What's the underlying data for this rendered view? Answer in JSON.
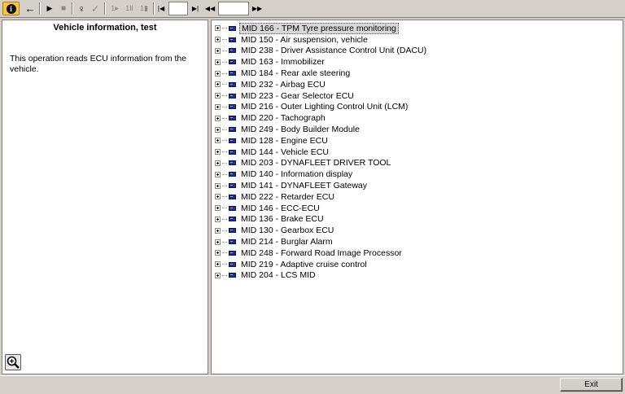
{
  "toolbar": {
    "info_glyph": "i",
    "back_glyph": "←",
    "play_glyph": "▶",
    "stop_glyph": "■",
    "inspect_glyph": "♀",
    "check_glyph": "✓",
    "step1_glyph": "1▸",
    "step2_glyph": "1Ⅱ",
    "step3_glyph": "1▮",
    "first_glyph": "|◀",
    "page_value": "",
    "last_glyph": "▶|",
    "rewind_glyph": "◀◀",
    "search_value": "",
    "forward_glyph": "▶▶"
  },
  "left_panel": {
    "title": "Vehicle information, test",
    "description": "This operation reads ECU information from the vehicle."
  },
  "tree": {
    "items": [
      {
        "label": "MID 166 - TPM Tyre pressure monitoring",
        "selected": true
      },
      {
        "label": "MID 150 - Air suspension, vehicle"
      },
      {
        "label": "MID 238 - Driver Assistance Control Unit (DACU)"
      },
      {
        "label": "MID 163 - Immobilizer"
      },
      {
        "label": "MID 184 - Rear axle steering"
      },
      {
        "label": "MID 232 - Airbag ECU"
      },
      {
        "label": "MID 223 - Gear Selector ECU"
      },
      {
        "label": "MID 216 - Outer Lighting Control Unit (LCM)"
      },
      {
        "label": "MID 220 - Tachograph"
      },
      {
        "label": "MID 249 - Body Builder Module"
      },
      {
        "label": "MID 128 - Engine ECU"
      },
      {
        "label": "MID 144 - Vehicle ECU"
      },
      {
        "label": "MID 203 - DYNAFLEET DRIVER TOOL"
      },
      {
        "label": "MID 140 - Information display"
      },
      {
        "label": "MID 141 - DYNAFLEET Gateway"
      },
      {
        "label": "MID 222 - Retarder ECU"
      },
      {
        "label": "MID 146 - ECC-ECU"
      },
      {
        "label": "MID 136 - Brake ECU"
      },
      {
        "label": "MID 130 - Gearbox ECU"
      },
      {
        "label": "MID 214 - Burglar Alarm"
      },
      {
        "label": "MID 248 - Forward Road Image Processor"
      },
      {
        "label": "MID 219 - Adaptive cruise control"
      },
      {
        "label": "MID 204 - LCS MID"
      }
    ]
  },
  "statusbar": {
    "exit_label": "Exit"
  },
  "colors": {
    "window_bg": "#d4d0c8",
    "info_button": "#f6c343",
    "ecu_icon": "#1f2f8c"
  }
}
